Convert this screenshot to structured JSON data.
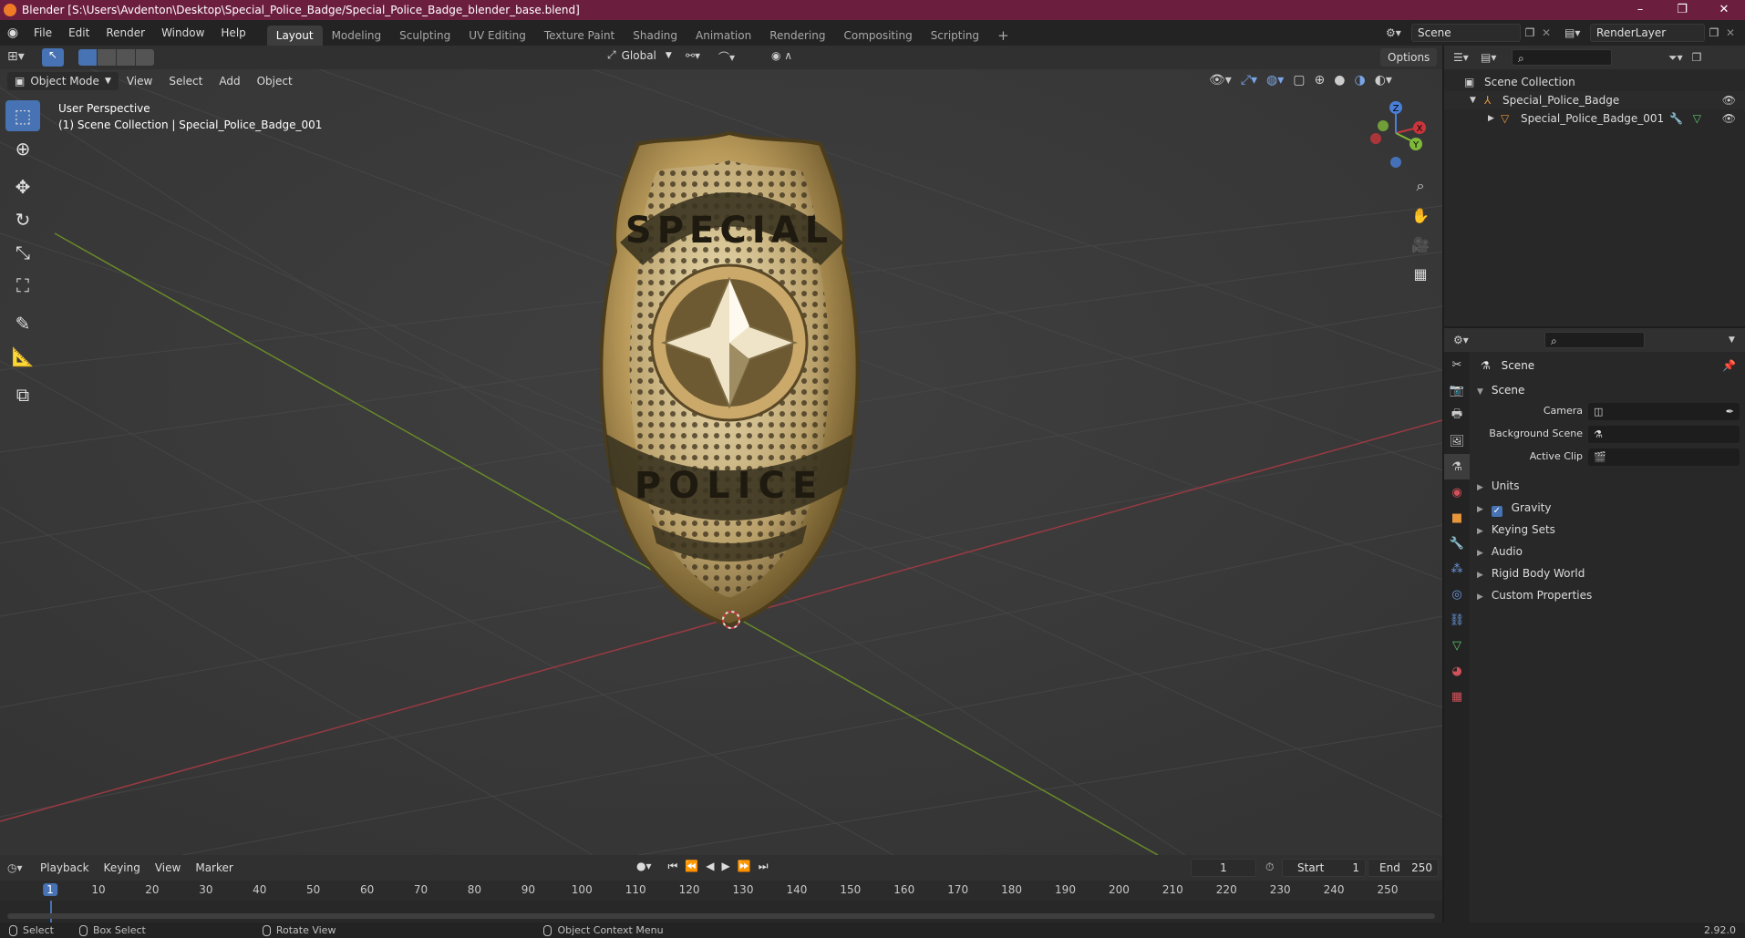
{
  "title_bar": {
    "title": "Blender [S:\\Users\\Avdenton\\Desktop\\Special_Police_Badge/Special_Police_Badge_blender_base.blend]",
    "controls": [
      "–",
      "❐",
      "✕"
    ]
  },
  "menu": {
    "items": [
      "File",
      "Edit",
      "Render",
      "Window",
      "Help"
    ],
    "workspaces": [
      "Layout",
      "Modeling",
      "Sculpting",
      "UV Editing",
      "Texture Paint",
      "Shading",
      "Animation",
      "Rendering",
      "Compositing",
      "Scripting"
    ],
    "add_workspace": "+",
    "scene_name": "Scene",
    "render_layer": "RenderLayer"
  },
  "viewport_header": {
    "transform_orientation": "Global",
    "options_label": "Options",
    "mode": "Object Mode",
    "menus": [
      "View",
      "Select",
      "Add",
      "Object"
    ]
  },
  "viewport": {
    "info_line1": "User Perspective",
    "info_line2": "(1) Scene Collection | Special_Police_Badge_001",
    "badge_text_top": "SPECIAL",
    "badge_text_bottom": "POLICE",
    "gizmo": {
      "x": "X",
      "y": "Y",
      "z": "Z"
    }
  },
  "outliner": {
    "root": "Scene Collection",
    "items": [
      {
        "label": "Special_Police_Badge",
        "indent": 1
      },
      {
        "label": "Special_Police_Badge_001",
        "indent": 2
      }
    ]
  },
  "properties": {
    "context_title": "Scene",
    "panel_title": "Scene",
    "fields": [
      {
        "label": "Camera",
        "value": ""
      },
      {
        "label": "Background Scene",
        "value": ""
      },
      {
        "label": "Active Clip",
        "value": ""
      }
    ],
    "subpanels": [
      "Units",
      "Gravity",
      "Keying Sets",
      "Audio",
      "Rigid Body World",
      "Custom Properties"
    ],
    "gravity_checked": true
  },
  "timeline": {
    "menus": [
      "Playback",
      "Keying",
      "View",
      "Marker"
    ],
    "current_frame": "1",
    "start_label": "Start",
    "start": "1",
    "end_label": "End",
    "end": "250",
    "ticks": [
      "1",
      "10",
      "20",
      "30",
      "40",
      "50",
      "60",
      "70",
      "80",
      "90",
      "100",
      "110",
      "120",
      "130",
      "140",
      "150",
      "160",
      "170",
      "180",
      "190",
      "200",
      "210",
      "220",
      "230",
      "240",
      "250"
    ]
  },
  "status_bar": {
    "select": "Select",
    "box_select": "Box Select",
    "rotate_view": "Rotate View",
    "context_menu": "Object Context Menu",
    "version": "2.92.0"
  }
}
